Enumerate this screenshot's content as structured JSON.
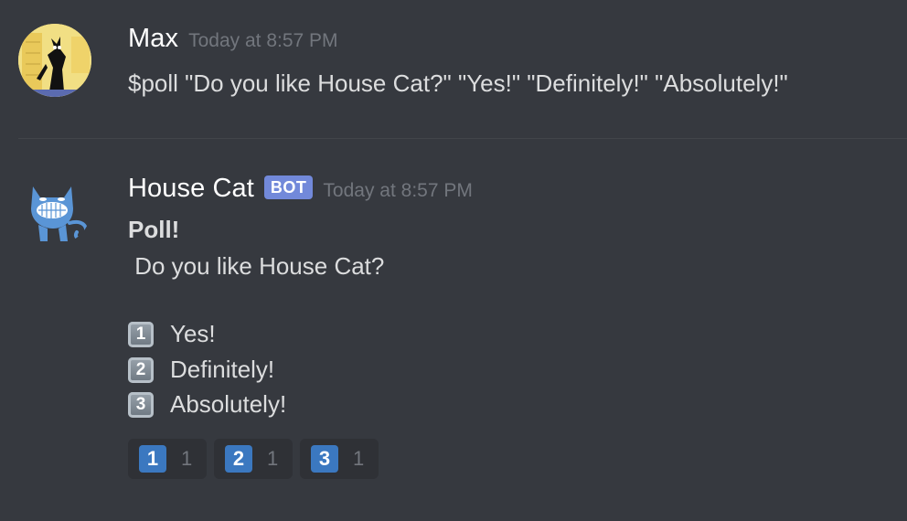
{
  "messages": [
    {
      "username": "Max",
      "timestamp": "Today at 8:57 PM",
      "content": "$poll \"Do you like House Cat?\" \"Yes!\" \"Definitely!\" \"Absolutely!\"",
      "avatar": "cartoon-character-avatar-icon"
    },
    {
      "username": "House Cat",
      "bot_tag": "BOT",
      "timestamp": "Today at 8:57 PM",
      "avatar": "blue-grinning-cat-icon",
      "poll": {
        "title": "Poll!",
        "question": " Do you like House Cat?",
        "options": [
          {
            "emoji": "1",
            "label": "Yes!"
          },
          {
            "emoji": "2",
            "label": "Definitely!"
          },
          {
            "emoji": "3",
            "label": "Absolutely!"
          }
        ]
      },
      "reactions": [
        {
          "emoji": "1",
          "count": "1"
        },
        {
          "emoji": "2",
          "count": "1"
        },
        {
          "emoji": "3",
          "count": "1"
        }
      ]
    }
  ],
  "colors": {
    "background": "#36393f",
    "username": "#ffffff",
    "timestamp": "#72767d",
    "bot_tag": "#7289da",
    "reaction_bg": "#2f3136",
    "reaction_emoji": "#3b78c0"
  }
}
